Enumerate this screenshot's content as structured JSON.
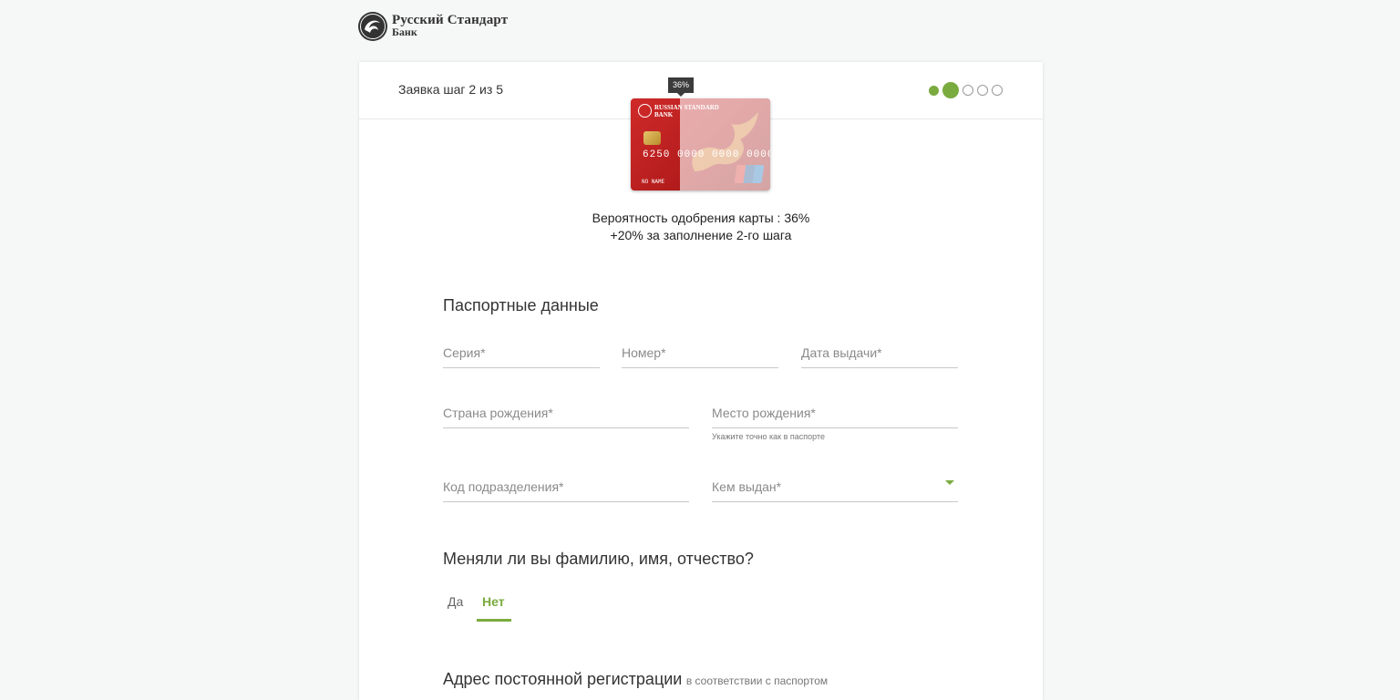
{
  "brand": {
    "line1": "Русский Стандарт",
    "line2": "Банк",
    "card_brand_line1": "RUSSIAN STANDARD",
    "card_brand_line2": "BANK"
  },
  "header": {
    "step_title": "Заявка шаг 2 из 5",
    "steps_total": 5,
    "current_step": 2
  },
  "card": {
    "probability_badge": "36%",
    "number": "6250 0000 0000 0000",
    "holder": "NO NAME"
  },
  "approval": {
    "line1": "Вероятность одобрения карты : 36%",
    "line2": "+20% за заполнение 2-го шага"
  },
  "passport": {
    "title": "Паспортные данные",
    "series_placeholder": "Серия*",
    "number_placeholder": "Номер*",
    "issue_date_placeholder": "Дата выдачи*",
    "birth_country_placeholder": "Страна рождения*",
    "birth_place_placeholder": "Место рождения*",
    "birth_place_hint": "Укажите точно как в паспорте",
    "department_code_placeholder": "Код подразделения*",
    "issued_by_placeholder": "Кем выдан*"
  },
  "name_change": {
    "title": "Меняли ли вы фамилию, имя, отчество?",
    "yes": "Да",
    "no": "Нет",
    "selected": "Нет"
  },
  "address": {
    "title": "Адрес постоянной регистрации",
    "subtitle": "в соответствии с паспортом"
  },
  "colors": {
    "accent": "#7aab3f",
    "card_red": "#c42323"
  }
}
